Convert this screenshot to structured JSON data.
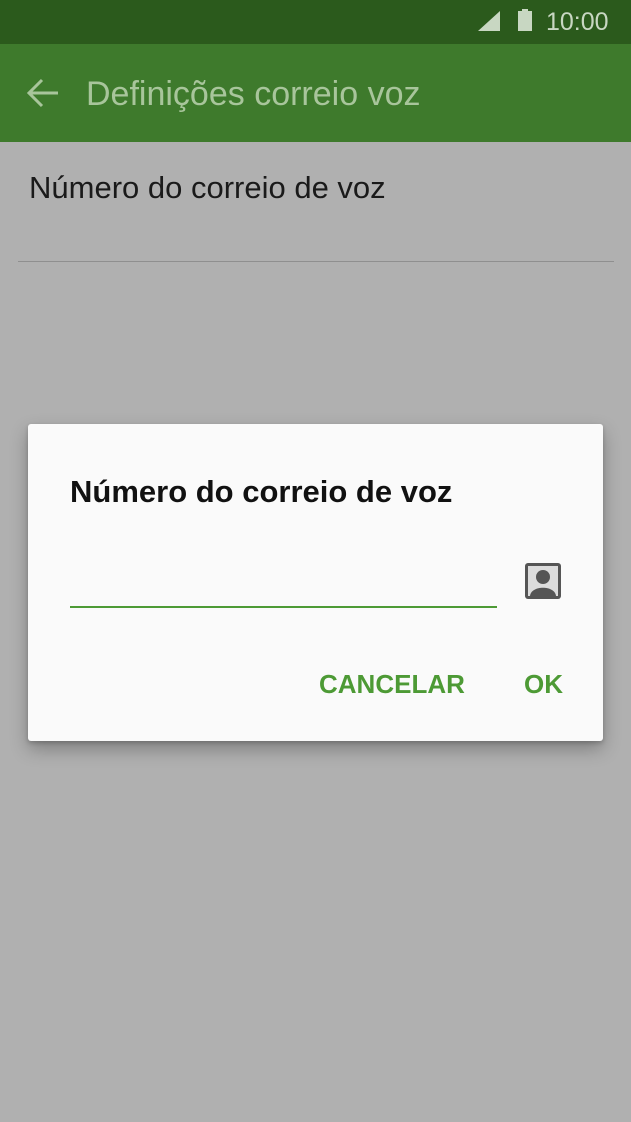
{
  "status_bar": {
    "time": "10:00",
    "icons": [
      "signal-icon",
      "battery-icon"
    ]
  },
  "app_bar": {
    "title": "Definições correio voz",
    "back_icon": "arrow-left-icon"
  },
  "settings": {
    "items": [
      {
        "label": "Número do correio de voz"
      }
    ]
  },
  "dialog": {
    "title": "Número do correio de voz",
    "input_value": "",
    "contact_icon": "contact-icon",
    "cancel_label": "CANCELAR",
    "ok_label": "OK"
  },
  "colors": {
    "status_bar": "#2b5a1c",
    "app_bar": "#3e7a2c",
    "accent": "#4d9a35",
    "dim_overlay": "#b0b0b0"
  }
}
